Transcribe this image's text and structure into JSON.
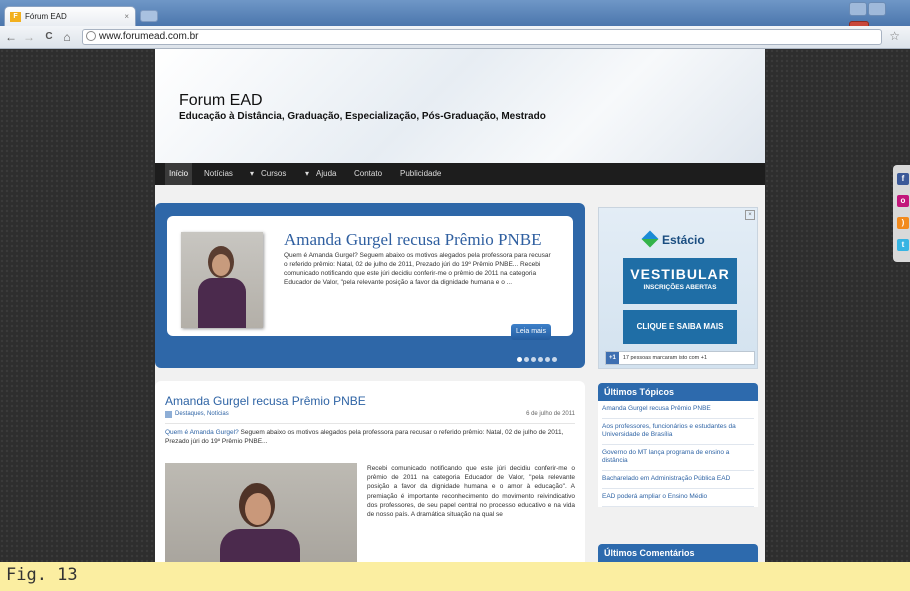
{
  "browser": {
    "tab_title": "Fórum EAD",
    "tab_close": "×",
    "url": "www.forumead.com.br",
    "back": "←",
    "forward": "→",
    "reload": "C",
    "home": "⌂",
    "bookmark_star": "☆"
  },
  "site": {
    "title": "Forum EAD",
    "tagline": "Educação à Distância, Graduação, Especialização, Pós-Graduação, Mestrado",
    "nav": [
      "Início",
      "Notícias",
      "Cursos",
      "Ajuda",
      "Contato",
      "Publicidade"
    ],
    "nav_dropdown_marker": "▾"
  },
  "slider": {
    "title": "Amanda Gurgel recusa Prêmio PNBE",
    "excerpt": "Quem é Amanda Gurgel? Seguem abaixo os motivos alegados pela professora para recusar o referido prêmio: Natal, 02 de julho de 2011, Prezado júri do 19º Prêmio PNBE... Recebi comunicado notificando que este júri decidiu conferir-me o prêmio de 2011 na categoria Educador de Valor, \"pela relevante posição a favor da dignidade humana e o ...",
    "read_more": "Leia mais",
    "dot_count": 6,
    "active_dot": 0
  },
  "post": {
    "title": "Amanda Gurgel recusa Prêmio PNBE",
    "categories": "Destaques, Notícias",
    "date": "6 de julho de 2011",
    "intro_link": "Quem é Amanda Gurgel?",
    "intro_rest": " Seguem abaixo os motivos alegados pela professora para recusar o referido prêmio: Natal, 02 de julho de 2011, Prezado júri do 19º Prêmio PNBE...",
    "body": "Recebi comunicado notificando que este júri decidiu conferir-me o prêmio de 2011 na categoria Educador de Valor, \"pela relevante posição a favor da dignidade humana e o amor à educação\". A premiação é importante reconhecimento do movimento reivindicativo dos professores, de seu papel central no processo educativo e na vida de nosso país. A dramática situação na qual se"
  },
  "ad": {
    "close": "×",
    "brand": "Estácio",
    "headline": "VESTIBULAR",
    "subheadline": "INSCRIÇÕES ABERTAS",
    "cta": "CLIQUE E SAIBA MAIS",
    "plus_one": "+1",
    "plus_one_text": "17 pessoas marcaram isto com +1"
  },
  "sidebar": {
    "topics_title": "Últimos Tópicos",
    "topics": [
      "Amanda Gurgel recusa Prêmio PNBE",
      "Aos professores, funcionários e estudantes da Universidade de Brasília",
      "Governo do MT lança programa de ensino a distância",
      "Bacharelado em Administração Pública EAD",
      "EAD poderá ampliar o Ensino Médio"
    ],
    "comments_title": "Últimos Comentários"
  },
  "social_icons": [
    "facebook-icon",
    "orkut-icon",
    "rss-icon",
    "twitter-icon"
  ],
  "caption": "Fig. 13"
}
